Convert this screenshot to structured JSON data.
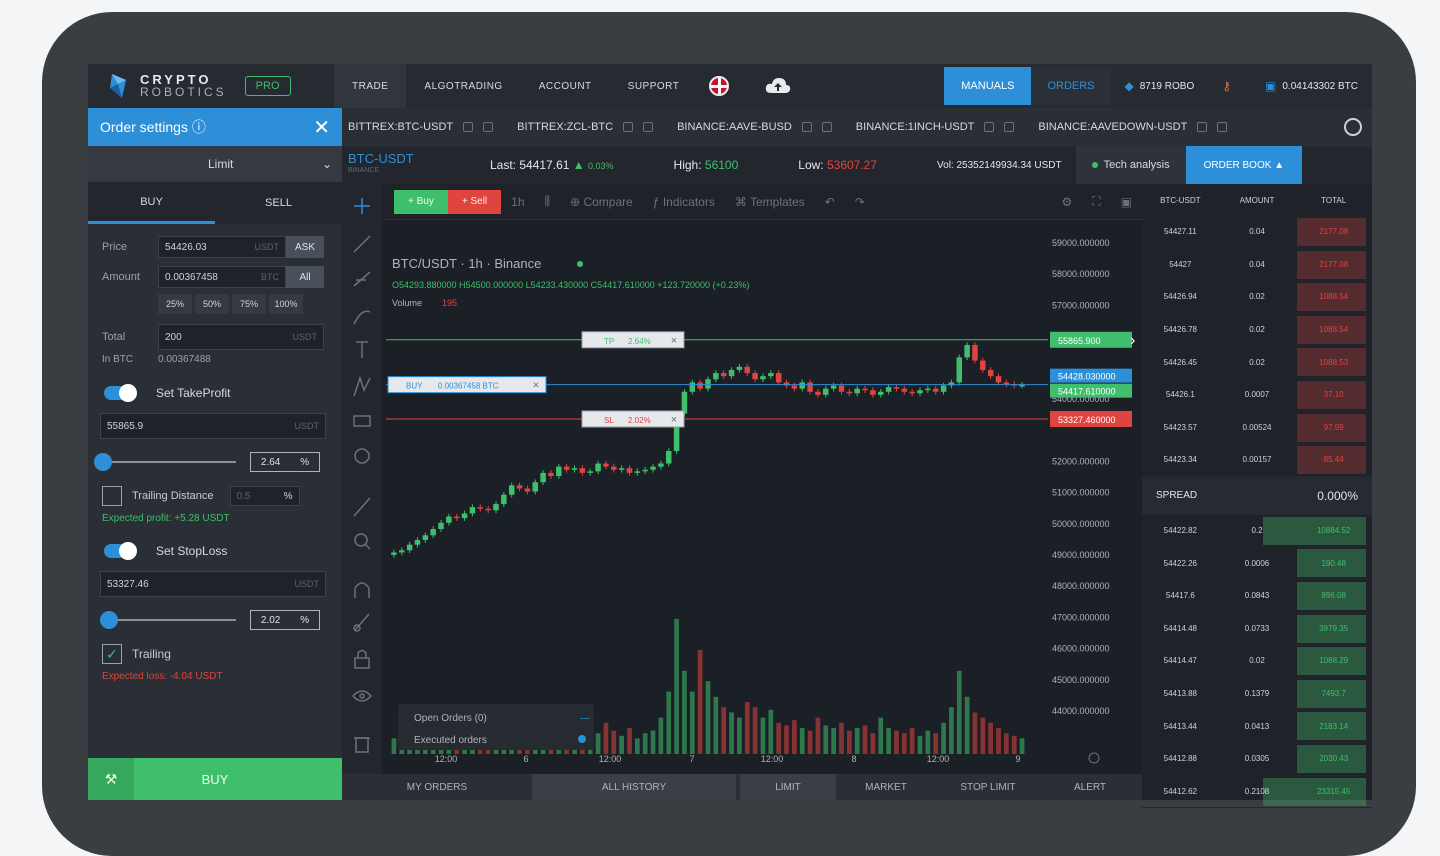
{
  "brand": {
    "name": "CRYPTO",
    "sub": "ROBOTICS",
    "badge": "PRO"
  },
  "nav": [
    {
      "label": "TRADE"
    },
    {
      "label": "ALGOTRADING"
    },
    {
      "label": "ACCOUNT"
    },
    {
      "label": "SUPPORT"
    }
  ],
  "top_right": {
    "manuals": "MANUALS",
    "orders": "ORDERS",
    "robo": "8719 ROBO",
    "balance": "0.04143302 BTC"
  },
  "order_settings": {
    "title": "Order settings ⓘ",
    "type": "Limit",
    "tab_buy": "BUY",
    "tab_sell": "SELL",
    "price_label": "Price",
    "price_value": "54426.03",
    "price_unit": "USDT",
    "ask_btn": "ASK",
    "amount_label": "Amount",
    "amount_value": "0.00367458",
    "amount_unit": "BTC",
    "all_btn": "All",
    "pcts": [
      "25%",
      "50%",
      "75%",
      "100%"
    ],
    "total_label": "Total",
    "total_value": "200",
    "total_unit": "USDT",
    "inbtc_label": "In BTC",
    "inbtc_value": "0.00367488",
    "tp_title": "Set TakeProfit",
    "tp_value": "55865.9",
    "tp_unit": "USDT",
    "tp_pct": "2.64",
    "pct_sign": "%",
    "trailing_distance": "Trailing Distance",
    "trailing_distance_value": "0.5",
    "expected_profit": "Expected profit: +5.28 USDT",
    "sl_title": "Set StopLoss",
    "sl_value": "53327.46",
    "sl_unit": "USDT",
    "sl_pct": "2.02",
    "trailing": "Trailing",
    "expected_loss": "Expected loss: -4.04 USDT",
    "buy_button": "BUY",
    "colors": {
      "accent": "#2d8fd8",
      "green": "#3fbf6b",
      "red": "#e0443f"
    }
  },
  "market_tabs": [
    "BITTREX:BTC-USDT",
    "BITTREX:ZCL-BTC",
    "BINANCE:AAVE-BUSD",
    "BINANCE:1INCH-USDT",
    "BINANCE:AAVEDOWN-USDT"
  ],
  "ticker": {
    "pair": "BTC-USDT",
    "exchange": "BINANCE",
    "last_label": "Last:",
    "last": "54417.61",
    "last_change": "0.03%",
    "high_label": "High:",
    "high": "56100",
    "low_label": "Low:",
    "low": "53607.27",
    "vol_label": "Vol:",
    "vol": "25352149934.34 USDT",
    "tech": "Tech analysis",
    "order_book": "ORDER BOOK ▲"
  },
  "chart_toolbar": {
    "buy": "+ Buy",
    "sell": "+ Sell",
    "interval": "1h",
    "compare": "Compare",
    "indicators": "Indicators",
    "templates": "Templates"
  },
  "chart_data": {
    "type": "candlestick",
    "title": "BTC/USDT · 1h · Binance",
    "ohlc_text": "O54293.880000 H54500.000000 L54233.430000 C54417.610000 +123.720000 (+0.23%)",
    "volume_label": "Volume",
    "volume_value": "195",
    "y_ticks": [
      "59000.000000",
      "58000.000000",
      "57000.000000",
      "54000.000000",
      "52000.000000",
      "51000.000000",
      "50000.000000",
      "49000.000000",
      "48000.000000",
      "47000.000000",
      "46000.000000",
      "45000.000000",
      "44000.000000"
    ],
    "x_ticks": [
      "12:00",
      "6",
      "12:00",
      "7",
      "12:00",
      "8",
      "12:00",
      "9"
    ],
    "tp_line": {
      "label": "TP",
      "pct": "2.64%",
      "price": "55865.900"
    },
    "buy_line": {
      "label": "BUY",
      "amount": "0.00367458 BTC",
      "price": "54428.030000",
      "last": "54417.610000"
    },
    "sl_line": {
      "label": "SL",
      "pct": "2.02%",
      "price": "53327.460000"
    },
    "closes": [
      49050,
      49120,
      49300,
      49450,
      49600,
      49800,
      50000,
      50200,
      50150,
      50300,
      50500,
      50450,
      50400,
      50600,
      50900,
      51200,
      51100,
      51000,
      51300,
      51600,
      51500,
      51800,
      51700,
      51750,
      51600,
      51650,
      51900,
      51800,
      51700,
      51750,
      51600,
      51650,
      51700,
      51800,
      51900,
      52300,
      53500,
      54200,
      54500,
      54300,
      54600,
      54800,
      54700,
      54900,
      55000,
      54800,
      54600,
      54700,
      54800,
      54500,
      54400,
      54300,
      54500,
      54200,
      54100,
      54300,
      54400,
      54200,
      54150,
      54300,
      54250,
      54100,
      54200,
      54350,
      54300,
      54200,
      54150,
      54250,
      54300,
      54200,
      54400,
      54500,
      55300,
      55700,
      55200,
      54900,
      54700,
      54500,
      54450,
      54400,
      54420
    ],
    "volumes": [
      30,
      40,
      25,
      50,
      35,
      45,
      60,
      40,
      30,
      55,
      35,
      45,
      50,
      40,
      70,
      55,
      45,
      35,
      60,
      50,
      40,
      65,
      55,
      45,
      50,
      35,
      40,
      60,
      45,
      35,
      50,
      30,
      40,
      45,
      70,
      120,
      260,
      160,
      120,
      200,
      140,
      110,
      90,
      80,
      70,
      100,
      90,
      70,
      85,
      60,
      55,
      65,
      50,
      45,
      70,
      55,
      50,
      60,
      45,
      50,
      55,
      40,
      70,
      50,
      45,
      40,
      50,
      35,
      45,
      40,
      60,
      90,
      160,
      110,
      80,
      70,
      60,
      50,
      40,
      35,
      30
    ]
  },
  "chart_widgets": {
    "open_orders": "Open Orders (0)",
    "executed": "Executed orders",
    "arrow": "›"
  },
  "bottom_tabs": [
    "MY ORDERS",
    "ALL HISTORY",
    "LIMIT",
    "MARKET",
    "STOP LIMIT",
    "ALERT"
  ],
  "order_book": {
    "headers": [
      "BTC-USDT",
      "AMOUNT",
      "TOTAL"
    ],
    "asks": [
      {
        "price": "54427.11",
        "amount": "0.04",
        "total": "2177.08",
        "fill": 0.3
      },
      {
        "price": "54427",
        "amount": "0.04",
        "total": "2177.08",
        "fill": 0.3
      },
      {
        "price": "54426.94",
        "amount": "0.02",
        "total": "1088.54",
        "fill": 0.3
      },
      {
        "price": "54426.78",
        "amount": "0.02",
        "total": "1088.54",
        "fill": 0.3
      },
      {
        "price": "54426.45",
        "amount": "0.02",
        "total": "1088.53",
        "fill": 0.3
      },
      {
        "price": "54426.1",
        "amount": "0.0007",
        "total": "37.10",
        "fill": 0.3
      },
      {
        "price": "54423.57",
        "amount": "0.00524",
        "total": "97.99",
        "fill": 0.3
      },
      {
        "price": "54423.34",
        "amount": "0.00157",
        "total": "85.44",
        "fill": 0.3
      }
    ],
    "spread_label": "SPREAD",
    "spread_value": "0.000%",
    "bids": [
      {
        "price": "54422.82",
        "amount": "0.2",
        "total": "10884.52",
        "fill": 0.45
      },
      {
        "price": "54422.26",
        "amount": "0.0006",
        "total": "190.48",
        "fill": 0.3
      },
      {
        "price": "54417.6",
        "amount": "0.0843",
        "total": "896.08",
        "fill": 0.3
      },
      {
        "price": "54414.48",
        "amount": "0.0733",
        "total": "3979.35",
        "fill": 0.3
      },
      {
        "price": "54414.47",
        "amount": "0.02",
        "total": "1088.29",
        "fill": 0.3
      },
      {
        "price": "54413.88",
        "amount": "0.1379",
        "total": "7493.7",
        "fill": 0.3
      },
      {
        "price": "54413.44",
        "amount": "0.0413",
        "total": "2183.14",
        "fill": 0.3
      },
      {
        "price": "54412.88",
        "amount": "0.0305",
        "total": "2030.43",
        "fill": 0.3
      },
      {
        "price": "54412.62",
        "amount": "0.2108",
        "total": "23315.45",
        "fill": 0.45
      }
    ]
  }
}
